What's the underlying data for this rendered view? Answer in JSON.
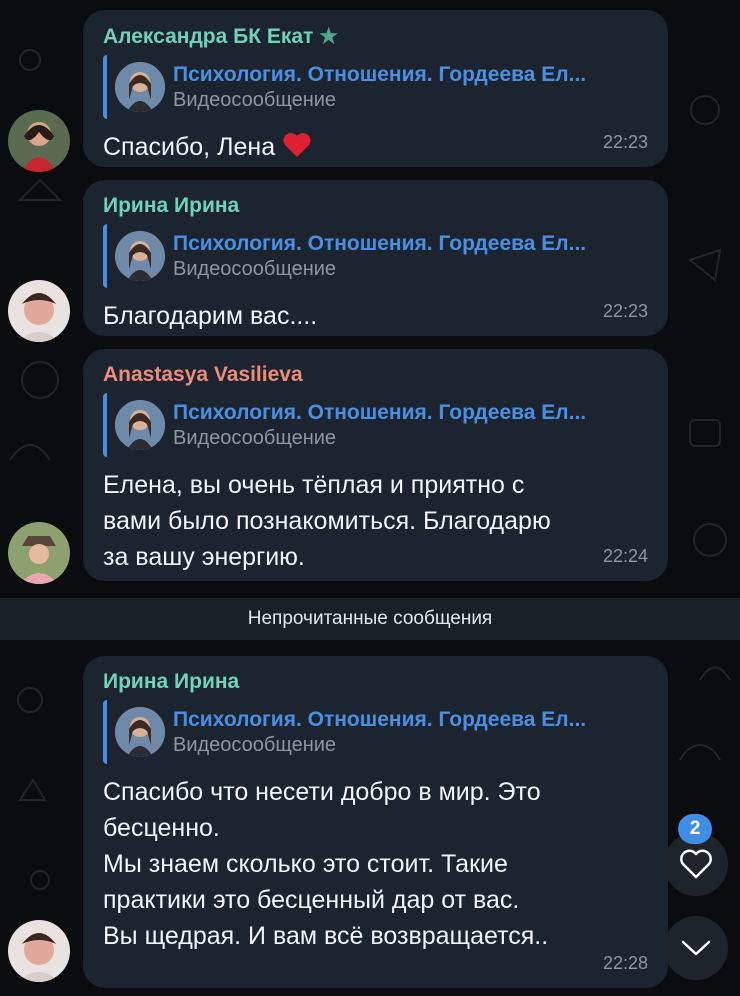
{
  "messages": [
    {
      "sender": "Александра БК Екат",
      "sender_color": "#6fd3b6",
      "reply_title": "Психология. Отношения. Гордеева Ел...",
      "reply_sub": "Видеосообщение",
      "text": "Спасибо, Лена",
      "emoji": "heart",
      "time": "22:23"
    },
    {
      "sender": "Ирина Ирина",
      "sender_color": "#6fd3b6",
      "reply_title": "Психология. Отношения. Гордеева Ел...",
      "reply_sub": "Видеосообщение",
      "text": "Благодарим вас....",
      "time": "22:23"
    },
    {
      "sender": "Anastasya Vasilieva",
      "sender_color": "#f08a7a",
      "reply_title": "Психология. Отношения. Гордеева Ел...",
      "reply_sub": "Видеосообщение",
      "text": "Елена, вы очень тёплая и приятно с\nвами было познакомиться. Благодарю\nза вашу энергию.",
      "time": "22:24"
    },
    {
      "sender": "Ирина Ирина",
      "sender_color": "#6fd3b6",
      "reply_title": "Психология. Отношения. Гордеева Ел...",
      "reply_sub": "Видеосообщение",
      "text": "Спасибо что несети добро в мир. Это\nбесценно.\nМы знаем сколько это стоит. Такие\nпрактики это бесценный  дар от вас.\nВы щедрая. И вам всё возвращается..",
      "time": "22:28"
    }
  ],
  "unread_label": "Непрочитанные сообщения",
  "reactions_badge": "2",
  "colors": {
    "accent": "#4a90e2",
    "bubble": "#1c2430",
    "badge": "#3f8de6"
  }
}
